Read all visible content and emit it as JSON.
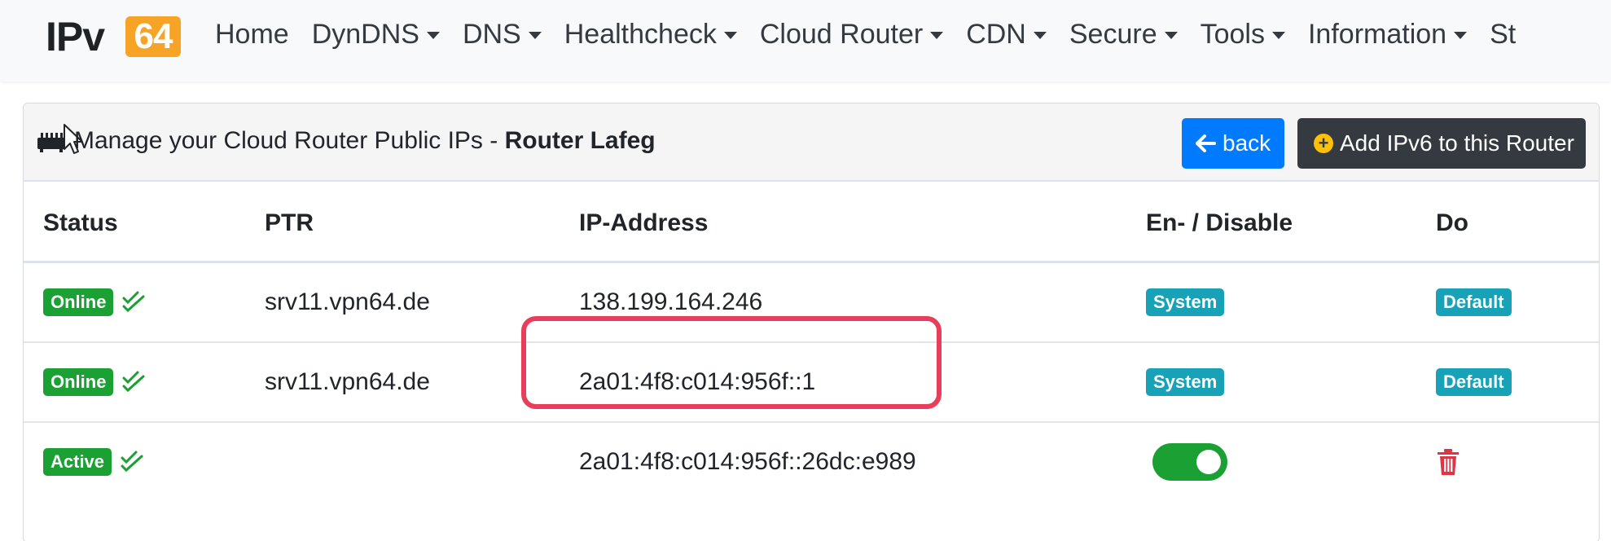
{
  "navbar": {
    "logo_ipv": "IPv",
    "logo_64": "64",
    "items": [
      {
        "label": "Home",
        "dropdown": false
      },
      {
        "label": "DynDNS",
        "dropdown": true
      },
      {
        "label": "DNS",
        "dropdown": true
      },
      {
        "label": "Healthcheck",
        "dropdown": true
      },
      {
        "label": "Cloud Router",
        "dropdown": true
      },
      {
        "label": "CDN",
        "dropdown": true
      },
      {
        "label": "Secure",
        "dropdown": true
      },
      {
        "label": "Tools",
        "dropdown": true
      },
      {
        "label": "Information",
        "dropdown": true
      },
      {
        "label": "St",
        "dropdown": false
      }
    ]
  },
  "card": {
    "title_prefix": "Manage your Cloud Router Public IPs - ",
    "router_name": "Router Lafeg",
    "back_label": "back",
    "add_label": "Add IPv6 to this Router",
    "icons": {
      "header": "router-icon",
      "back": "arrow-left-icon",
      "add": "plus-circle-icon"
    }
  },
  "table": {
    "headers": [
      "Status",
      "PTR",
      "IP-Address",
      "En- / Disable",
      "Do"
    ],
    "rows": [
      {
        "status": "Online",
        "ptr": "srv11.vpn64.de",
        "ip": "138.199.164.246",
        "enable": "System",
        "do": "Default"
      },
      {
        "status": "Online",
        "ptr": "srv11.vpn64.de",
        "ip": "2a01:4f8:c014:956f::1",
        "enable": "System",
        "do": "Default"
      },
      {
        "status": "Active",
        "ptr": "",
        "ip": "2a01:4f8:c014:956f::26dc:e989",
        "enable_toggle": true,
        "do_icon": "trash-icon"
      }
    ]
  },
  "colors": {
    "brand_orange": "#f7a325",
    "primary": "#007bff",
    "dark": "#343a40",
    "success": "#1aa033",
    "info": "#17a2b8",
    "danger": "#dc3545",
    "highlight": "#e83e5c"
  }
}
